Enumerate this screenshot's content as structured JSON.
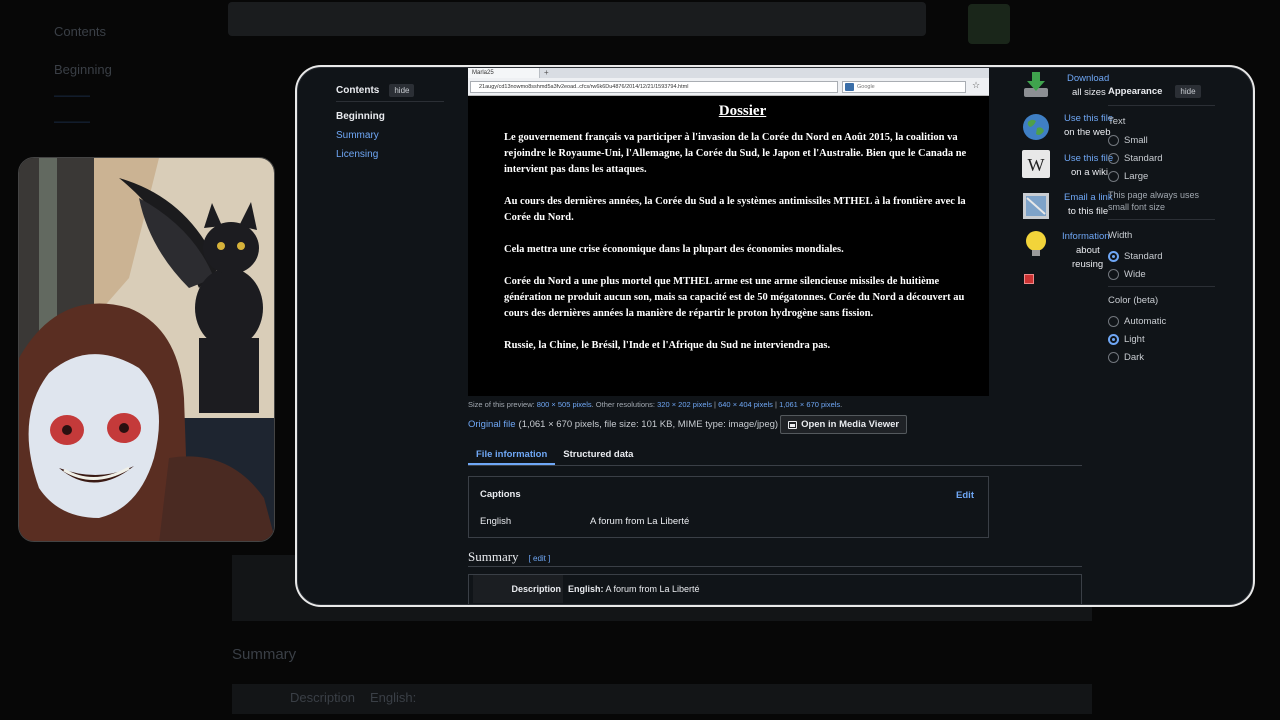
{
  "toc": {
    "title": "Contents",
    "hide": "hide",
    "items": [
      "Beginning",
      "Summary",
      "Licensing"
    ]
  },
  "shot": {
    "tab_title": "Marla25",
    "url": "21augy/cd13nowmo8sshmd5a3fv2eoad..cfcs/rw6k6Du4876/2014/12/21/1593794.html",
    "search_placeholder": "Google",
    "title": "Dossier",
    "paragraphs": [
      "Le gouvernement français va participer à l'invasion de la Corée du Nord en Août 2015, la coalition va rejoindre le Royaume-Uni, l'Allemagne, la Corée du Sud, le Japon et l'Australie. Bien que le Canada ne intervient pas dans les attaques.",
      "Au cours des dernières années, la Corée du Sud a le systèmes antimissiles MTHEL à la frontière avec la Corée du Nord.",
      "Cela mettra une crise économique dans la plupart des économies mondiales.",
      "Corée du Nord a une plus mortel que MTHEL arme est une arme silencieuse missiles de huitième génération ne produit aucun son, mais sa capacité est de 50 mégatonnes. Corée du Nord a découvert au cours des dernières années la manière de répartir le proton hydrogène sans fission.",
      "Russie, la Chine, le Brésil, l'Inde et l'Afrique du Sud ne interviendra pas."
    ]
  },
  "preview": {
    "label": "Size of this preview:",
    "current": "800 × 505 pixels",
    "other_label": ". Other resolutions:",
    "res1": "320 × 202 pixels",
    "sep": "|",
    "res2": "640 × 404 pixels",
    "res3": "1,061 × 670 pixels",
    "end": "."
  },
  "original": {
    "link": "Original file",
    "details": "(1,061 × 670 pixels, file size: 101 KB, MIME type: image/jpeg)",
    "media_viewer": "Open in Media Viewer"
  },
  "tabs": [
    "File information",
    "Structured data"
  ],
  "captions": {
    "title": "Captions",
    "edit": "Edit",
    "language": "English",
    "value": "A forum from La Liberté"
  },
  "summary": {
    "heading": "Summary",
    "edit": "[ edit ]",
    "desc_key": "Description",
    "desc_lang": "English:",
    "desc_value": "A forum from La Liberté"
  },
  "tools": {
    "download": "Download",
    "download_sub": "all sizes",
    "use_web": "Use this file",
    "use_web_sub": "on the web",
    "use_wiki": "Use this file",
    "use_wiki_sub": "on a wiki",
    "email": "Email a link",
    "email_sub": "to this file",
    "info": "Information",
    "info_sub1": "about",
    "info_sub2": "reusing"
  },
  "appearance": {
    "title": "Appearance",
    "hide": "hide",
    "text_label": "Text",
    "text_options": [
      "Small",
      "Standard",
      "Large"
    ],
    "note": "This page always uses small font size",
    "width_label": "Width",
    "width_options": [
      "Standard",
      "Wide"
    ],
    "color_label": "Color (beta)",
    "color_options": [
      "Automatic",
      "Light",
      "Dark"
    ]
  },
  "backdrop": {
    "toc_title": "Contents",
    "toc_first": "Beginning",
    "summary_heading": "Summary",
    "desc_key": "Description",
    "desc_value": "English:"
  }
}
